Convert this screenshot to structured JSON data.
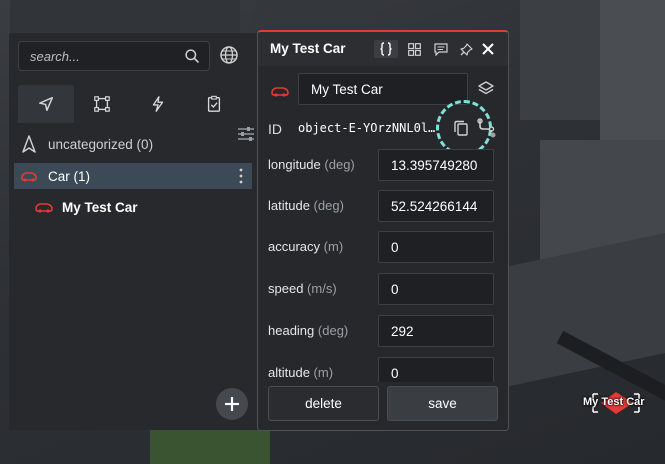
{
  "search": {
    "placeholder": "search..."
  },
  "categories": [
    {
      "label": "uncategorized (0)"
    },
    {
      "label": "Car (1)"
    }
  ],
  "objects": [
    {
      "label": "My Test Car"
    }
  ],
  "editor": {
    "title": "My Test Car",
    "name_value": "My Test Car",
    "id_label": "ID",
    "id_value": "object-E-YOrzNNL0l…",
    "fields": [
      {
        "label": "longitude",
        "unit": "(deg)",
        "value": "13.395749280"
      },
      {
        "label": "latitude",
        "unit": "(deg)",
        "value": "52.524266144"
      },
      {
        "label": "accuracy",
        "unit": "(m)",
        "value": "0"
      },
      {
        "label": "speed",
        "unit": "(m/s)",
        "value": "0"
      },
      {
        "label": "heading",
        "unit": "(deg)",
        "value": "292"
      },
      {
        "label": "altitude",
        "unit": "(m)",
        "value": "0"
      }
    ],
    "delete_label": "delete",
    "save_label": "save"
  },
  "map_marker": {
    "label": "My Test Car"
  },
  "colors": {
    "accent_red": "#e53935",
    "highlight": "#7fe0d6",
    "selected_row": "#3c4a57"
  }
}
